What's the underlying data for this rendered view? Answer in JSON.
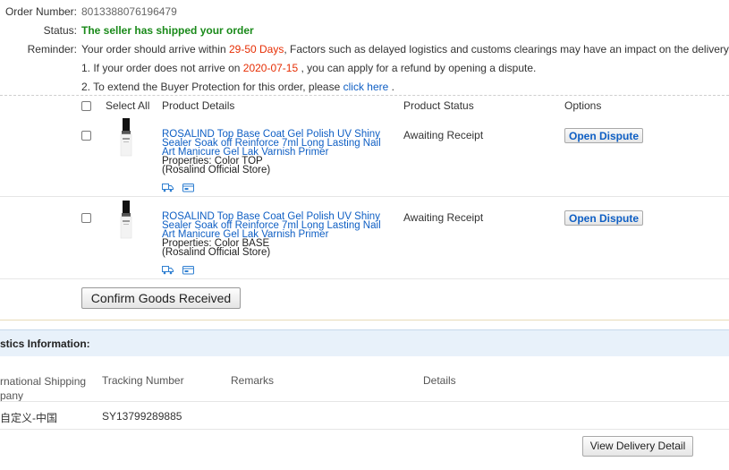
{
  "order": {
    "number_label": "Order Number:",
    "number": "8013388076196479",
    "status_label": "Status:",
    "status": "The seller has shipped your order",
    "reminder_label": "Reminder:",
    "reminder_pre": "Your order should arrive within ",
    "reminder_days": "29-50 Days",
    "reminder_post": ", Factors such as delayed logistics and customs clearings may have an impact on the delivery time.",
    "note1_pre": "1. If your order does not arrive on ",
    "note1_date": "2020-07-15",
    "note1_post": " , you can apply for a refund by opening a dispute.",
    "note2_pre": "2. To extend the Buyer Protection for this order, please ",
    "note2_link": "click here",
    "note2_post": " ."
  },
  "table": {
    "headers": {
      "select_all": "Select All",
      "product_details": "Product Details",
      "product_status": "Product Status",
      "options": "Options"
    },
    "rows": [
      {
        "title": "ROSALIND Top Base Coat Gel Polish UV Shiny Sealer Soak off Reinforce 7ml Long Lasting Nail Art Manicure Gel Lak Varnish Primer",
        "properties": "Properties: Color TOP",
        "store": "(Rosalind Official Store)",
        "status": "Awaiting Receipt",
        "action": "Open Dispute"
      },
      {
        "title": "ROSALIND Top Base Coat Gel Polish UV Shiny Sealer Soak off Reinforce 7ml Long Lasting Nail Art Manicure Gel Lak Varnish Primer",
        "properties": "Properties: Color BASE",
        "store": "(Rosalind Official Store)",
        "status": "Awaiting Receipt",
        "action": "Open Dispute"
      }
    ],
    "confirm_button": "Confirm Goods Received"
  },
  "logistics": {
    "heading": "stics Information:",
    "columns": {
      "company_line1": "rnational Shipping",
      "company_line2": "pany",
      "tracking": "Tracking Number",
      "remarks": "Remarks",
      "details": "Details"
    },
    "row": {
      "company": "自定义-中国",
      "tracking": "SY13799289885"
    },
    "view_button": "View Delivery Detail"
  },
  "icons": [
    "checkbox",
    "product-thumbnail",
    "logistics-truck-icon",
    "card-icon"
  ],
  "colors": {
    "status_green": "#1a8a1a",
    "highlight_red": "#e62e04",
    "link_blue": "#0f5fc4",
    "logistics_bar": "#e8f1fa"
  }
}
